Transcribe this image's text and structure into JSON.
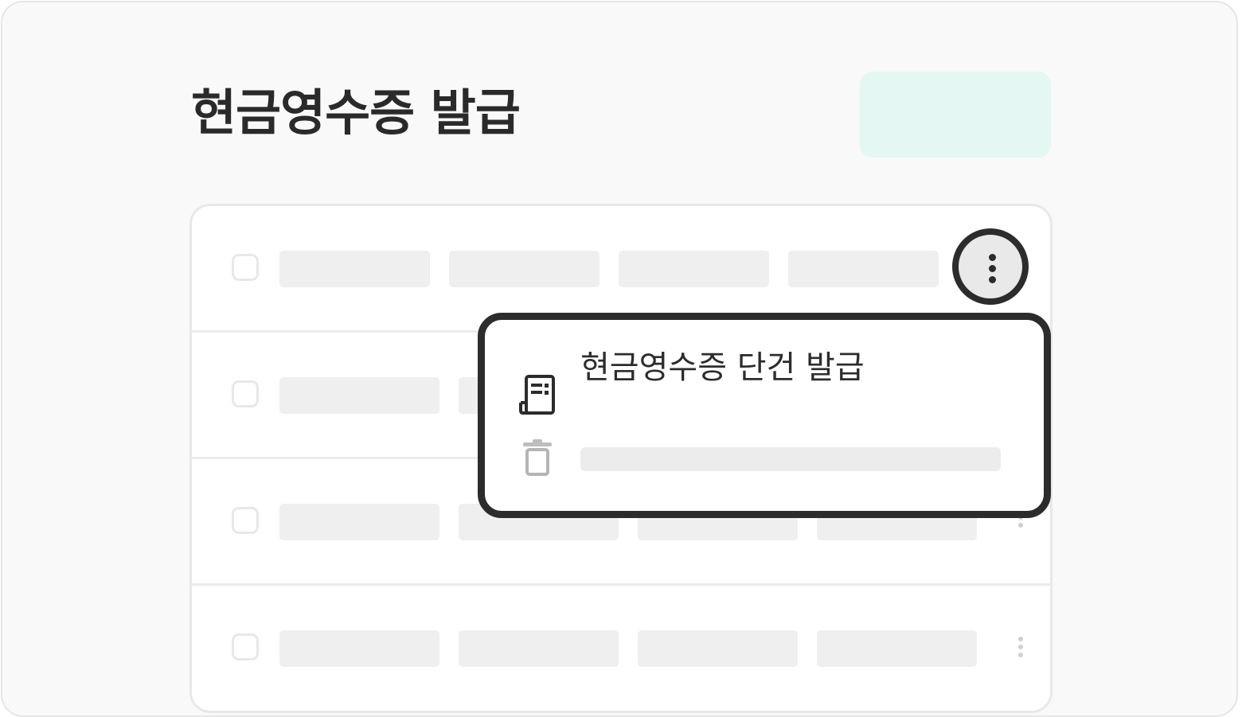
{
  "header": {
    "title": "현금영수증 발급"
  },
  "row_menu": {
    "items": [
      {
        "label": "현금영수증 단건 발급",
        "icon": "receipt-icon"
      },
      {
        "label": "",
        "icon": "trash-icon"
      }
    ]
  },
  "colors": {
    "accent_soft": "#e4f7f2",
    "ink": "#2c2c2c",
    "placeholder": "#efefef"
  }
}
